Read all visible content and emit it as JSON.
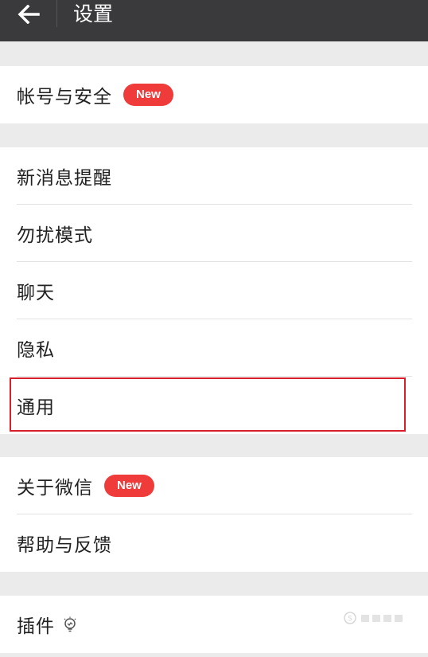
{
  "header": {
    "title": "设置"
  },
  "groups": {
    "account": {
      "items": [
        {
          "label": "帐号与安全",
          "badge": "New"
        }
      ]
    },
    "main": {
      "items": [
        {
          "label": "新消息提醒"
        },
        {
          "label": "勿扰模式"
        },
        {
          "label": "聊天"
        },
        {
          "label": "隐私"
        },
        {
          "label": "通用"
        }
      ]
    },
    "about": {
      "items": [
        {
          "label": "关于微信",
          "badge": "New"
        },
        {
          "label": "帮助与反馈"
        }
      ]
    },
    "plugins": {
      "items": [
        {
          "label": "插件",
          "icon": "plugin-bulb-icon"
        }
      ]
    }
  },
  "colors": {
    "topbar": "#3a3a3c",
    "badge": "#f03b3b",
    "highlight": "#d8202c",
    "background": "#ebebeb"
  }
}
